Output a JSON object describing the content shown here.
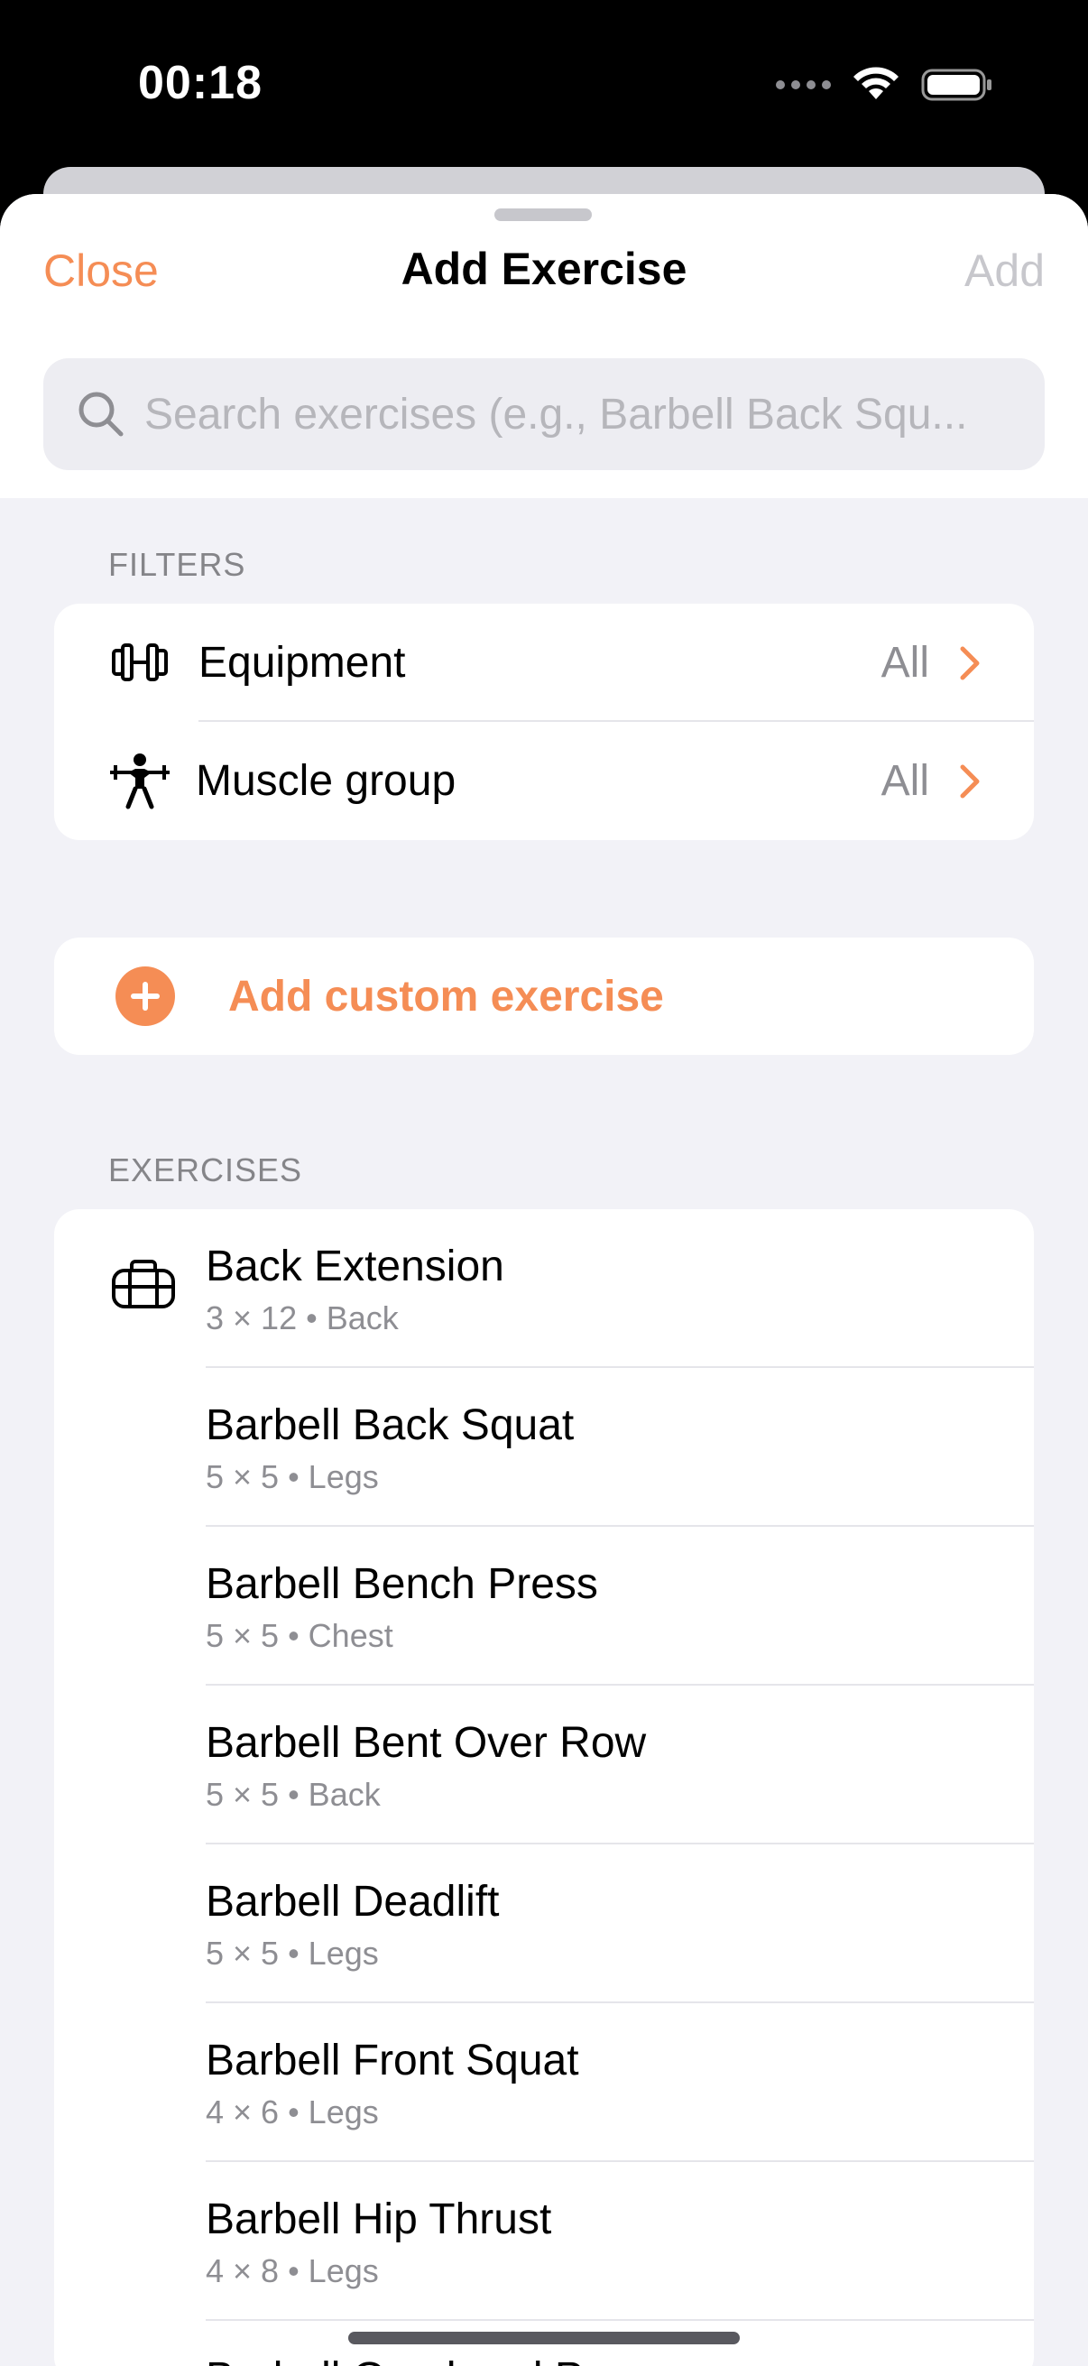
{
  "status_bar": {
    "time": "00:18"
  },
  "nav": {
    "close_label": "Close",
    "title": "Add Exercise",
    "add_label": "Add"
  },
  "search": {
    "placeholder": "Search exercises (e.g., Barbell Back Squ..."
  },
  "filters": {
    "section_label": "FILTERS",
    "items": [
      {
        "label": "Equipment",
        "value": "All"
      },
      {
        "label": "Muscle group",
        "value": "All"
      }
    ]
  },
  "custom": {
    "label": "Add custom exercise"
  },
  "exercises": {
    "section_label": "EXERCISES",
    "items": [
      {
        "name": "Back Extension",
        "detail": "3 × 12 • Back"
      },
      {
        "name": "Barbell Back Squat",
        "detail": "5 × 5 • Legs"
      },
      {
        "name": "Barbell Bench Press",
        "detail": "5 × 5 • Chest"
      },
      {
        "name": "Barbell Bent Over Row",
        "detail": "5 × 5 • Back"
      },
      {
        "name": "Barbell Deadlift",
        "detail": "5 × 5 • Legs"
      },
      {
        "name": "Barbell Front Squat",
        "detail": "4 × 6 • Legs"
      },
      {
        "name": "Barbell Hip Thrust",
        "detail": "4 × 8 • Legs"
      },
      {
        "name": "Barbell Overhead Press",
        "detail": ""
      }
    ]
  },
  "colors": {
    "accent": "#f58d55",
    "background": "#f2f2f7",
    "secondary_text": "#8e8e93"
  },
  "icons": {
    "equipment": "dumbbell-icon",
    "muscle_group": "weightlifter-icon",
    "exercise": "gym-bag-icon",
    "search": "magnifier-icon",
    "add_custom": "plus-circle-icon"
  }
}
